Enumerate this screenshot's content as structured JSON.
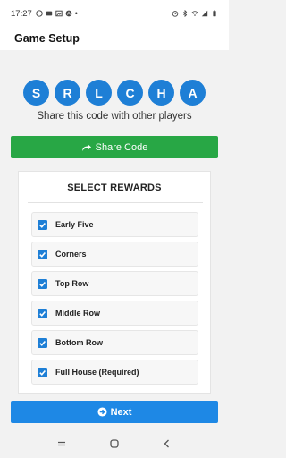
{
  "status_bar": {
    "time": "17:27",
    "left_icons": [
      "whatsapp-icon",
      "chat-icon",
      "gallery-icon",
      "app-icon"
    ],
    "dot": "•",
    "right_icons": [
      "alarm-icon",
      "bluetooth-icon",
      "wifi-icon",
      "signal-icon",
      "battery-icon"
    ]
  },
  "app_bar": {
    "title": "Game Setup"
  },
  "code": {
    "chars": [
      "S",
      "R",
      "L",
      "C",
      "H",
      "A"
    ]
  },
  "share_text": "Share this code with other players",
  "share_button": {
    "label": "Share Code",
    "icon": "share-icon"
  },
  "rewards_card": {
    "title": "SELECT REWARDS",
    "items": [
      {
        "label": "Early Five",
        "checked": true
      },
      {
        "label": "Corners",
        "checked": true
      },
      {
        "label": "Top Row",
        "checked": true
      },
      {
        "label": "Middle Row",
        "checked": true
      },
      {
        "label": "Bottom Row",
        "checked": true
      },
      {
        "label": "Full House (Required)",
        "checked": true
      }
    ]
  },
  "next_button": {
    "label": "Next",
    "icon": "arrow-right-circle-icon"
  },
  "nav_bar": {
    "buttons": [
      "recents-icon",
      "home-icon",
      "back-icon"
    ]
  },
  "colors": {
    "accent": "#1e7fd6",
    "share_green": "#28a745",
    "next_blue": "#1e88e5"
  }
}
